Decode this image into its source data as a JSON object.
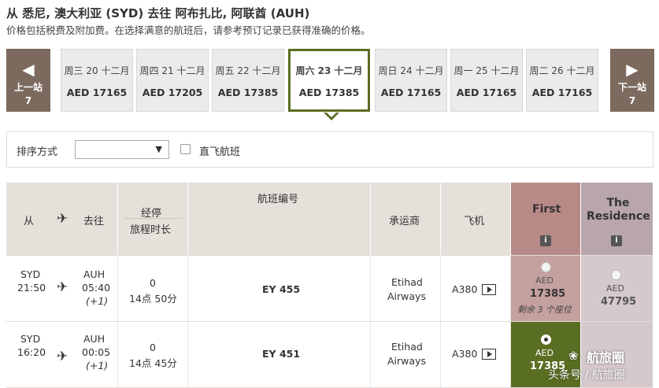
{
  "header": {
    "title": "从 悉尼, 澳大利亚 (SYD) 去往 阿布扎比, 阿联酋 (AUH)",
    "subtitle": "价格包括税费及附加费。在选择满意的航班后，请参考预订记录已获得准确的价格。"
  },
  "date_nav": {
    "prev": {
      "label": "上一站",
      "count": "7",
      "arrow": "◀"
    },
    "next": {
      "label": "下一站",
      "count": "7",
      "arrow": "▶"
    },
    "days": [
      {
        "date": "周三 20 十二月",
        "price": "AED 17165"
      },
      {
        "date": "周四 21 十二月",
        "price": "AED 17205"
      },
      {
        "date": "周五 22 十二月",
        "price": "AED 17385"
      },
      {
        "date": "周六 23 十二月",
        "price": "AED 17385"
      },
      {
        "date": "周日 24 十二月",
        "price": "AED 17165"
      },
      {
        "date": "周一 25 十二月",
        "price": "AED 17165"
      },
      {
        "date": "周二 26 十二月",
        "price": "AED 17165"
      }
    ]
  },
  "sort": {
    "label": "排序方式",
    "selected": "",
    "direct_label": "直飞航班"
  },
  "table": {
    "headers": {
      "from": "从",
      "to": "去往",
      "stops": "经停",
      "duration": "旅程时长",
      "flight_no": "航班编号",
      "carrier": "承运商",
      "aircraft": "飞机",
      "first": "First",
      "residence": "The Residence",
      "info": "i"
    },
    "rows": [
      {
        "from_code": "SYD",
        "dep_time": "21:50",
        "to_code": "AUH",
        "arr_time": "05:40",
        "day_offset": "(+1)",
        "stops": "0",
        "duration": "14点 50分",
        "flight": "EY 455",
        "carrier_line1": "Etihad",
        "carrier_line2": "Airways",
        "aircraft": "A380",
        "first_currency": "AED",
        "first_price": "17385",
        "first_note": "剩余 3 个座位",
        "res_currency": "AED",
        "res_price": "47795"
      },
      {
        "from_code": "SYD",
        "dep_time": "16:20",
        "to_code": "AUH",
        "arr_time": "00:05",
        "day_offset": "(+1)",
        "stops": "0",
        "duration": "14点 45分",
        "flight": "EY 451",
        "carrier_line1": "Etihad",
        "carrier_line2": "Airways",
        "aircraft": "A380",
        "first_currency": "AED",
        "first_price": "17385"
      }
    ]
  },
  "watermark": {
    "brand": "航旅圈",
    "line": "头条号 / 航旅圈"
  },
  "colors": {
    "nav_brown": "#7d6a5f",
    "selected_green": "#5a6e23",
    "first_header": "#b88a87",
    "residence_header": "#b9a6ad"
  }
}
